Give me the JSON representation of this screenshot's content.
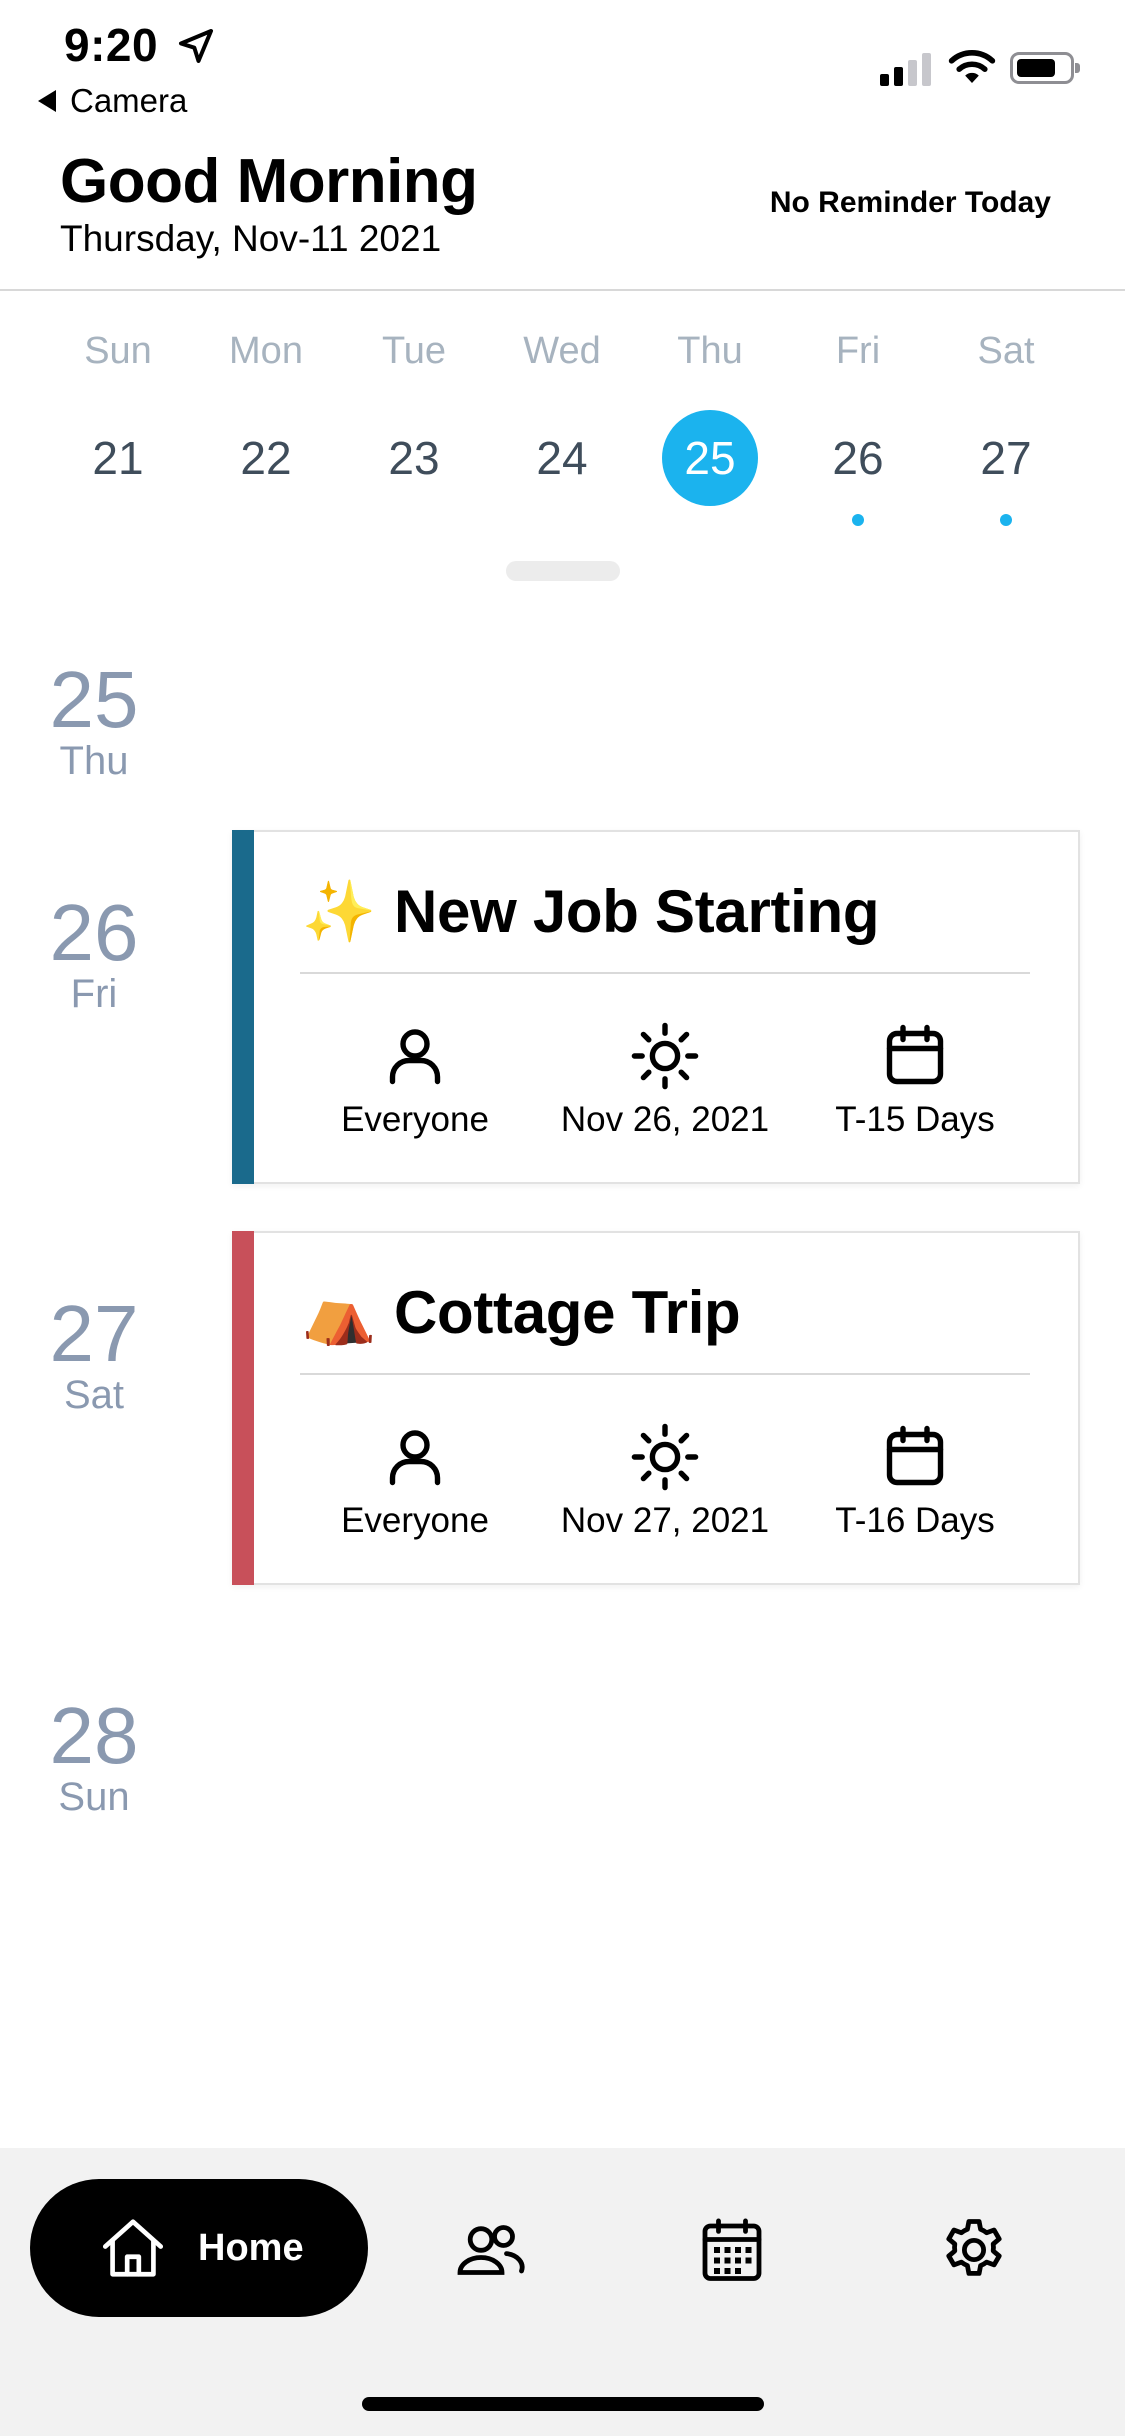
{
  "status_bar": {
    "time": "9:20",
    "back_label": "Camera"
  },
  "header": {
    "greeting": "Good Morning",
    "date": "Thursday, Nov-11 2021",
    "reminder": "No Reminder Today"
  },
  "week": [
    {
      "dow": "Sun",
      "day": "21",
      "selected": false,
      "has_event": false
    },
    {
      "dow": "Mon",
      "day": "22",
      "selected": false,
      "has_event": false
    },
    {
      "dow": "Tue",
      "day": "23",
      "selected": false,
      "has_event": false
    },
    {
      "dow": "Wed",
      "day": "24",
      "selected": false,
      "has_event": false
    },
    {
      "dow": "Thu",
      "day": "25",
      "selected": true,
      "has_event": false
    },
    {
      "dow": "Fri",
      "day": "26",
      "selected": false,
      "has_event": true
    },
    {
      "dow": "Sat",
      "day": "27",
      "selected": false,
      "has_event": true
    }
  ],
  "timeline": [
    {
      "day": "25",
      "dow": "Thu"
    },
    {
      "day": "26",
      "dow": "Fri"
    },
    {
      "day": "27",
      "dow": "Sat"
    },
    {
      "day": "28",
      "dow": "Sun"
    }
  ],
  "events": [
    {
      "emoji": "✨",
      "title": "New Job Starting",
      "stripe_color": "#1a6a8c",
      "audience": "Everyone",
      "date": "Nov 26, 2021",
      "countdown": "T-15 Days"
    },
    {
      "emoji": "⛺",
      "title": "Cottage Trip",
      "stripe_color": "#c8505a",
      "audience": "Everyone",
      "date": "Nov 27, 2021",
      "countdown": "T-16 Days"
    }
  ],
  "nav": {
    "home_label": "Home",
    "icons": [
      "home-icon",
      "people-icon",
      "calendar-icon",
      "gear-icon"
    ]
  },
  "colors": {
    "accent": "#1bb3ee",
    "timeline_text": "#8a99b0"
  }
}
